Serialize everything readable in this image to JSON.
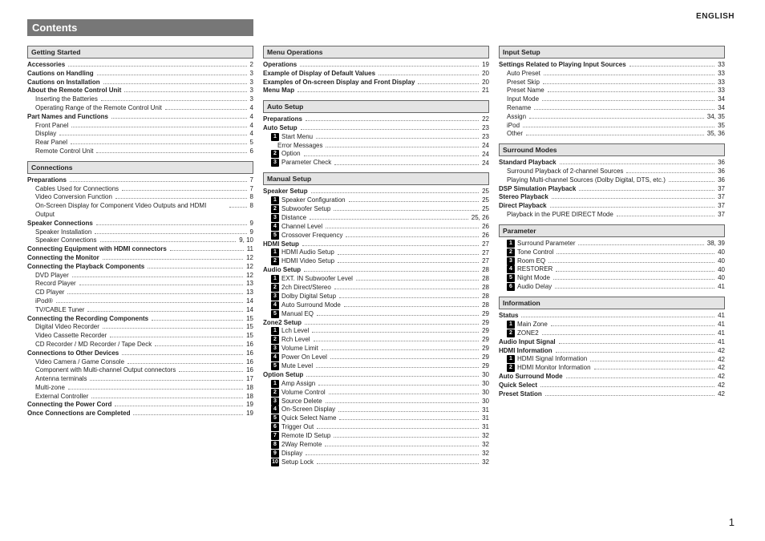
{
  "language": "ENGLISH",
  "page_number": "1",
  "title": "Contents",
  "columns": [
    {
      "sections": [
        {
          "heading": "Getting Started",
          "rows": [
            {
              "l": "Accessories",
              "p": "2",
              "b": 1
            },
            {
              "l": "Cautions on Handling",
              "p": "3",
              "b": 1
            },
            {
              "l": "Cautions on Installation",
              "p": "3",
              "b": 1
            },
            {
              "l": "About the Remote Control Unit",
              "p": "3",
              "b": 1
            },
            {
              "l": "Inserting the Batteries",
              "p": "3",
              "s": 1
            },
            {
              "l": "Operating Range of the Remote Control Unit",
              "p": "4",
              "s": 1
            },
            {
              "l": "Part Names and Functions",
              "p": "4",
              "b": 1
            },
            {
              "l": "Front Panel",
              "p": "4",
              "s": 1
            },
            {
              "l": "Display",
              "p": "4",
              "s": 1
            },
            {
              "l": "Rear Panel",
              "p": "5",
              "s": 1
            },
            {
              "l": "Remote Control Unit",
              "p": "6",
              "s": 1
            }
          ]
        },
        {
          "heading": "Connections",
          "rows": [
            {
              "l": "Preparations",
              "p": "7",
              "b": 1
            },
            {
              "l": "Cables Used for Connections",
              "p": "7",
              "s": 1
            },
            {
              "l": "Video Conversion Function",
              "p": "8",
              "s": 1
            },
            {
              "l": "On-Screen Display for Component Video Outputs and HDMI Output",
              "p": "8",
              "s": 1,
              "w": 1
            },
            {
              "l": "Speaker Connections",
              "p": "9",
              "b": 1
            },
            {
              "l": "Speaker Installation",
              "p": "9",
              "s": 1
            },
            {
              "l": "Speaker Connections",
              "p": "9, 10",
              "s": 1
            },
            {
              "l": "Connecting Equipment with HDMI connectors",
              "p": "11",
              "b": 1
            },
            {
              "l": "Connecting the Monitor",
              "p": "12",
              "b": 1
            },
            {
              "l": "Connecting the Playback Components",
              "p": "12",
              "b": 1
            },
            {
              "l": "DVD Player",
              "p": "12",
              "s": 1
            },
            {
              "l": "Record Player",
              "p": "13",
              "s": 1
            },
            {
              "l": "CD Player",
              "p": "13",
              "s": 1
            },
            {
              "l": "iPod®",
              "p": "14",
              "s": 1
            },
            {
              "l": "TV/CABLE Tuner",
              "p": "14",
              "s": 1
            },
            {
              "l": "Connecting the Recording Components",
              "p": "15",
              "b": 1
            },
            {
              "l": "Digital Video Recorder",
              "p": "15",
              "s": 1
            },
            {
              "l": "Video Cassette Recorder",
              "p": "15",
              "s": 1
            },
            {
              "l": "CD Recorder / MD Recorder / Tape Deck",
              "p": "16",
              "s": 1
            },
            {
              "l": "Connections to Other Devices",
              "p": "16",
              "b": 1
            },
            {
              "l": "Video Camera / Game Console",
              "p": "16",
              "s": 1
            },
            {
              "l": "Component with Multi-channel Output connectors",
              "p": "16",
              "s": 1
            },
            {
              "l": "Antenna terminals",
              "p": "17",
              "s": 1
            },
            {
              "l": "Multi-zone",
              "p": "18",
              "s": 1
            },
            {
              "l": "External Controller",
              "p": "18",
              "s": 1
            },
            {
              "l": "Connecting the Power Cord",
              "p": "19",
              "b": 1
            },
            {
              "l": "Once Connections are Completed",
              "p": "19",
              "b": 1
            }
          ]
        }
      ]
    },
    {
      "sections": [
        {
          "heading": "Menu Operations",
          "rows": [
            {
              "l": "Operations",
              "p": "19",
              "b": 1
            },
            {
              "l": "Example of Display of Default Values",
              "p": "20",
              "b": 1
            },
            {
              "l": "Examples of On-screen Display and Front Display",
              "p": "20",
              "b": 1
            },
            {
              "l": "Menu Map",
              "p": "21",
              "b": 1
            }
          ]
        },
        {
          "heading": "Auto Setup",
          "rows": [
            {
              "l": "Preparations",
              "p": "22",
              "b": 1
            },
            {
              "l": "Auto Setup",
              "p": "23",
              "b": 1
            },
            {
              "n": "1",
              "l": "Start Menu",
              "p": "23",
              "s": 1
            },
            {
              "l": "Error Messages",
              "p": "24",
              "s": 2
            },
            {
              "n": "2",
              "l": "Option",
              "p": "24",
              "s": 1
            },
            {
              "n": "3",
              "l": "Parameter Check",
              "p": "24",
              "s": 1
            }
          ]
        },
        {
          "heading": "Manual Setup",
          "rows": [
            {
              "l": "Speaker Setup",
              "p": "25",
              "b": 1
            },
            {
              "n": "1",
              "l": "Speaker Configuration",
              "p": "25",
              "s": 1
            },
            {
              "n": "2",
              "l": "Subwoofer Setup",
              "p": "25",
              "s": 1
            },
            {
              "n": "3",
              "l": "Distance",
              "p": "25, 26",
              "s": 1
            },
            {
              "n": "4",
              "l": "Channel Level",
              "p": "26",
              "s": 1
            },
            {
              "n": "5",
              "l": "Crossover Frequency",
              "p": "26",
              "s": 1
            },
            {
              "l": "HDMI Setup",
              "p": "27",
              "b": 1
            },
            {
              "n": "1",
              "l": "HDMI Audio Setup",
              "p": "27",
              "s": 1
            },
            {
              "n": "2",
              "l": "HDMI Video Setup",
              "p": "27",
              "s": 1
            },
            {
              "l": "Audio Setup",
              "p": "28",
              "b": 1
            },
            {
              "n": "1",
              "l": "EXT. IN Subwoofer Level",
              "p": "28",
              "s": 1
            },
            {
              "n": "2",
              "l": "2ch Direct/Stereo",
              "p": "28",
              "s": 1
            },
            {
              "n": "3",
              "l": "Dolby Digital Setup",
              "p": "28",
              "s": 1
            },
            {
              "n": "4",
              "l": "Auto Surround Mode",
              "p": "28",
              "s": 1
            },
            {
              "n": "5",
              "l": "Manual EQ",
              "p": "29",
              "s": 1
            },
            {
              "l": "Zone2 Setup",
              "p": "29",
              "b": 1
            },
            {
              "n": "1",
              "l": "Lch Level",
              "p": "29",
              "s": 1
            },
            {
              "n": "2",
              "l": "Rch Level",
              "p": "29",
              "s": 1
            },
            {
              "n": "3",
              "l": "Volume Limit",
              "p": "29",
              "s": 1
            },
            {
              "n": "4",
              "l": "Power On Level",
              "p": "29",
              "s": 1
            },
            {
              "n": "5",
              "l": "Mute Level",
              "p": "29",
              "s": 1
            },
            {
              "l": "Option Setup",
              "p": "30",
              "b": 1
            },
            {
              "n": "1",
              "l": "Amp Assign",
              "p": "30",
              "s": 1
            },
            {
              "n": "2",
              "l": "Volume Control",
              "p": "30",
              "s": 1
            },
            {
              "n": "3",
              "l": "Source Delete",
              "p": "30",
              "s": 1
            },
            {
              "n": "4",
              "l": "On-Screen Display",
              "p": "31",
              "s": 1
            },
            {
              "n": "5",
              "l": "Quick Select Name",
              "p": "31",
              "s": 1
            },
            {
              "n": "6",
              "l": "Trigger Out",
              "p": "31",
              "s": 1
            },
            {
              "n": "7",
              "l": "Remote ID Setup",
              "p": "32",
              "s": 1
            },
            {
              "n": "8",
              "l": "2Way Remote",
              "p": "32",
              "s": 1
            },
            {
              "n": "9",
              "l": "Display",
              "p": "32",
              "s": 1
            },
            {
              "n": "10",
              "l": "Setup Lock",
              "p": "32",
              "s": 1
            }
          ]
        }
      ]
    },
    {
      "sections": [
        {
          "heading": "Input Setup",
          "rows": [
            {
              "l": "Settings Related to Playing Input Sources",
              "p": "33",
              "b": 1
            },
            {
              "l": "Auto Preset",
              "p": "33",
              "s": 1
            },
            {
              "l": "Preset Skip",
              "p": "33",
              "s": 1
            },
            {
              "l": "Preset Name",
              "p": "33",
              "s": 1
            },
            {
              "l": "Input Mode",
              "p": "34",
              "s": 1
            },
            {
              "l": "Rename",
              "p": "34",
              "s": 1
            },
            {
              "l": "Assign",
              "p": "34, 35",
              "s": 1
            },
            {
              "l": "iPod",
              "p": "35",
              "s": 1
            },
            {
              "l": "Other",
              "p": "35, 36",
              "s": 1
            }
          ]
        },
        {
          "heading": "Surround Modes",
          "rows": [
            {
              "l": "Standard Playback",
              "p": "36",
              "b": 1
            },
            {
              "l": "Surround Playback of 2-channel Sources",
              "p": "36",
              "s": 1
            },
            {
              "l": "Playing Multi-channel Sources (Dolby Digital, DTS, etc.)",
              "p": "36",
              "s": 1
            },
            {
              "l": "DSP Simulation Playback",
              "p": "37",
              "b": 1
            },
            {
              "l": "Stereo Playback",
              "p": "37",
              "b": 1
            },
            {
              "l": "Direct Playback",
              "p": "37",
              "b": 1
            },
            {
              "l": "Playback in the PURE DIRECT Mode",
              "p": "37",
              "s": 1
            }
          ]
        },
        {
          "heading": "Parameter",
          "rows": [
            {
              "n": "1",
              "l": "Surround Parameter",
              "p": "38, 39",
              "s": 1
            },
            {
              "n": "2",
              "l": "Tone Control",
              "p": "40",
              "s": 1
            },
            {
              "n": "3",
              "l": "Room EQ",
              "p": "40",
              "s": 1
            },
            {
              "n": "4",
              "l": "RESTORER",
              "p": "40",
              "s": 1
            },
            {
              "n": "5",
              "l": "Night Mode",
              "p": "40",
              "s": 1
            },
            {
              "n": "6",
              "l": "Audio Delay",
              "p": "41",
              "s": 1
            }
          ]
        },
        {
          "heading": "Information",
          "rows": [
            {
              "l": "Status",
              "p": "41",
              "b": 1
            },
            {
              "n": "1",
              "l": "Main Zone",
              "p": "41",
              "s": 1
            },
            {
              "n": "2",
              "l": "ZONE2",
              "p": "41",
              "s": 1
            },
            {
              "l": "Audio Input Signal",
              "p": "41",
              "b": 1
            },
            {
              "l": "HDMI Information",
              "p": "42",
              "b": 1
            },
            {
              "n": "1",
              "l": "HDMI Signal Information",
              "p": "42",
              "s": 1
            },
            {
              "n": "2",
              "l": "HDMI Monitor Information",
              "p": "42",
              "s": 1
            },
            {
              "l": "Auto Surround Mode",
              "p": "42",
              "b": 1
            },
            {
              "l": "Quick Select",
              "p": "42",
              "b": 1
            },
            {
              "l": "Preset Station",
              "p": "42",
              "b": 1
            }
          ]
        }
      ]
    }
  ]
}
